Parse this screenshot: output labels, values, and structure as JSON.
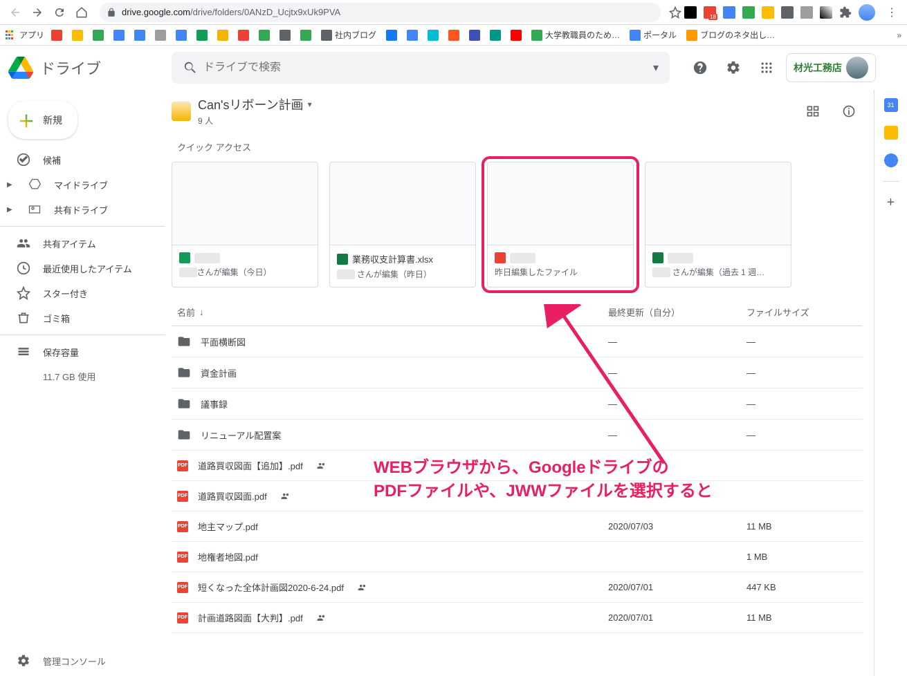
{
  "browser": {
    "url_host": "drive.google.com",
    "url_path": "/drive/folders/0ANzD_Ucjtx9xUk9PVA",
    "bookmarks_label": "アプリ",
    "bookmarks": [
      {
        "label": "",
        "color": "#ea4335"
      },
      {
        "label": "",
        "color": "#fbbc04"
      },
      {
        "label": "",
        "color": "#34a853"
      },
      {
        "label": "",
        "color": "#4285f4"
      },
      {
        "label": "",
        "color": "#4285f4"
      },
      {
        "label": "",
        "color": "#9e9e9e"
      },
      {
        "label": "",
        "color": "#4285f4"
      },
      {
        "label": "",
        "color": "#0f9d58"
      },
      {
        "label": "",
        "color": "#f4b400"
      },
      {
        "label": "",
        "color": "#ea4335"
      },
      {
        "label": "",
        "color": "#34a853"
      },
      {
        "label": "",
        "color": "#5f6368"
      },
      {
        "label": "",
        "color": "#34a853"
      },
      {
        "label": "社内ブログ",
        "color": "#5f6368"
      },
      {
        "label": "",
        "color": "#1877f2"
      },
      {
        "label": "",
        "color": "#4285f4"
      },
      {
        "label": "",
        "color": "#00bcd4"
      },
      {
        "label": "",
        "color": "#ff5722"
      },
      {
        "label": "",
        "color": "#3f51b5"
      },
      {
        "label": "",
        "color": "#009688"
      },
      {
        "label": "",
        "color": "#ff0000"
      },
      {
        "label": "大学教職員のため…",
        "color": "#34a853"
      },
      {
        "label": "ポータル",
        "color": "#4285f4"
      },
      {
        "label": "ブログのネタ出し…",
        "color": "#ff9800"
      }
    ]
  },
  "drive": {
    "brand": "ドライブ",
    "search_placeholder": "ドライブで検索",
    "new_button": "新規",
    "org_label": "材光工務店",
    "nav": {
      "candidate": "候補",
      "mydrive": "マイドライブ",
      "shareddrives": "共有ドライブ",
      "shared": "共有アイテム",
      "recent": "最近使用したアイテム",
      "starred": "スター付き",
      "trash": "ゴミ箱",
      "storage": "保存容量",
      "storage_used": "11.7 GB 使用",
      "admin": "管理コンソール"
    }
  },
  "folder": {
    "title": "Can'sリボーン計画",
    "subtitle": "9 人"
  },
  "quick_access": {
    "title": "クイック アクセス",
    "cards": [
      {
        "name": "████",
        "sub": "███さんが編集（今日）",
        "type": "sheets"
      },
      {
        "name": "業務収支計算書.xlsx",
        "sub": "███ さんが編集（昨日）",
        "type": "excel"
      },
      {
        "name": "████",
        "sub": "昨日編集したファイル",
        "type": "pdf",
        "highlight": true
      },
      {
        "name": "████",
        "sub": "███ さんが編集（過去 1 週…",
        "type": "excel"
      }
    ]
  },
  "list": {
    "col_name": "名前",
    "col_date": "最終更新（自分）",
    "col_size": "ファイルサイズ",
    "rows": [
      {
        "type": "folder",
        "name": "平面横断図",
        "date": "—",
        "size": "—"
      },
      {
        "type": "folder",
        "name": "資金計画",
        "date": "—",
        "size": "—"
      },
      {
        "type": "folder",
        "name": "議事録",
        "date": "—",
        "size": "—"
      },
      {
        "type": "folder",
        "name": "リニューアル配置案",
        "date": "—",
        "size": "—"
      },
      {
        "type": "pdf",
        "name": "道路買収図面【追加】.pdf",
        "date": "",
        "size": "",
        "shared": true
      },
      {
        "type": "pdf",
        "name": "道路買収図面.pdf",
        "date": "",
        "size": "",
        "shared": true
      },
      {
        "type": "pdf",
        "name": "地主マップ.pdf",
        "date": "2020/07/03",
        "size": "11 MB"
      },
      {
        "type": "pdf",
        "name": "地権者地図.pdf",
        "date": "",
        "size": "1 MB"
      },
      {
        "type": "pdf",
        "name": "短くなった全体計画図2020-6-24.pdf",
        "date": "2020/07/01",
        "size": "447 KB",
        "shared": true
      },
      {
        "type": "pdf",
        "name": "計画道路図面【大判】.pdf",
        "date": "2020/07/01",
        "size": "11 MB",
        "shared": true
      }
    ]
  },
  "annotation": {
    "line1": "WEBブラウザから、Googleドライブの",
    "line2": "PDFファイルや、JWWファイルを選択すると"
  }
}
